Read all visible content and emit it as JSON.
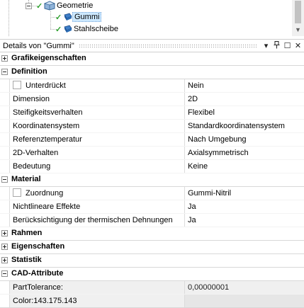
{
  "tree": {
    "root_label": "Geometrie",
    "children": [
      {
        "label": "Gummi",
        "selected": true
      },
      {
        "label": "Stahlscheibe",
        "selected": false
      }
    ]
  },
  "panel": {
    "title": "Details von \"Gummi\"",
    "buttons": {
      "menu": "▾",
      "pin": "🖈",
      "restore": "☐",
      "close": "✕"
    }
  },
  "grid": {
    "categories": {
      "grafik": "Grafikeigenschaften",
      "definition": "Definition",
      "material": "Material",
      "rahmen": "Rahmen",
      "eigenschaften": "Eigenschaften",
      "statistik": "Statistik",
      "cad": "CAD-Attribute"
    },
    "definition_rows": [
      {
        "name": "Unterdrückt",
        "value": "Nein",
        "checkbox": true
      },
      {
        "name": "Dimension",
        "value": "2D"
      },
      {
        "name": "Steifigkeitsverhalten",
        "value": "Flexibel"
      },
      {
        "name": "Koordinatensystem",
        "value": "Standardkoordinatensystem"
      },
      {
        "name": "Referenztemperatur",
        "value": "Nach Umgebung"
      },
      {
        "name": "2D-Verhalten",
        "value": "Axialsymmetrisch"
      },
      {
        "name": "Bedeutung",
        "value": "Keine"
      }
    ],
    "material_rows": [
      {
        "name": "Zuordnung",
        "value": "Gummi-Nitril",
        "checkbox": true
      },
      {
        "name": "Nichtlineare Effekte",
        "value": "Ja"
      },
      {
        "name": "Berücksichtigung der thermischen Dehnungen",
        "value": "Ja"
      }
    ],
    "cad_rows": [
      {
        "name": "PartTolerance:",
        "value": "0,00000001"
      },
      {
        "name": "Color:143.175.143",
        "value": ""
      }
    ]
  },
  "colors": {
    "check": "#2ea02e",
    "selection": "#cce8ff",
    "cad_bg": "#f0f0f0"
  }
}
